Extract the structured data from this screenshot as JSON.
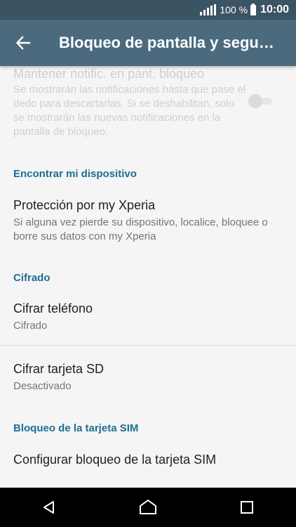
{
  "status_bar": {
    "battery_percent": "100 %",
    "time": "10:00",
    "icons": [
      "signal-icon",
      "battery-icon"
    ]
  },
  "app_bar": {
    "title": "Bloqueo de pantalla y seguridad",
    "back_icon": "arrow-left-icon"
  },
  "settings": {
    "notif_lock": {
      "title": "Mantener notific. en pant. bloqueo",
      "subtitle": "Se mostrarán las notificaciones hasta que pase el dedo para descartarlas. Si se deshabilitan, solo se mostrarán las nuevas notificaciones en la pantalla de bloqueo.",
      "enabled": false,
      "toggle_on": false
    },
    "find_device": {
      "header": "Encontrar mi dispositivo",
      "title": "Protección por my Xperia",
      "subtitle": "Si alguna vez pierde su dispositivo, localice, bloquee o borre sus datos con my Xperia"
    },
    "encryption": {
      "header": "Cifrado",
      "phone_title": "Cifrar teléfono",
      "phone_status": "Cifrado",
      "sd_title": "Cifrar tarjeta SD",
      "sd_status": "Desactivado"
    },
    "sim_lock": {
      "header": "Bloqueo de la tarjeta SIM",
      "title": "Configurar bloqueo de la tarjeta SIM"
    }
  },
  "nav_bar": {
    "icons": [
      "back-triangle-icon",
      "home-icon",
      "recents-icon"
    ]
  },
  "colors": {
    "status_bar": "#3b5464",
    "app_bar": "#4b6a7d",
    "section_header": "#1e6d93",
    "background": "#f5f5f5"
  }
}
